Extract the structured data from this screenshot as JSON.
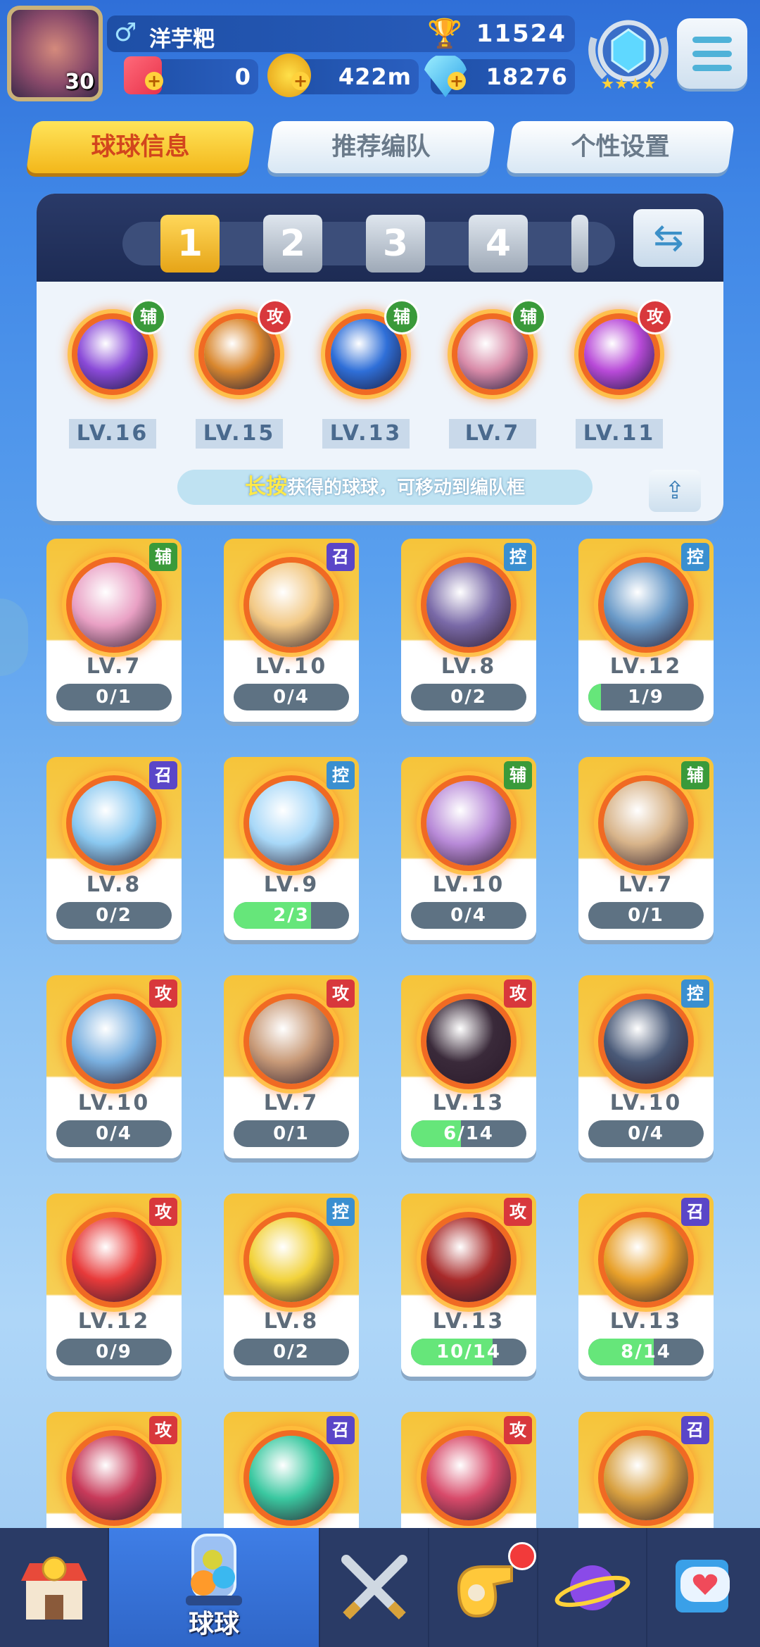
{
  "player": {
    "level": "30",
    "gender_icon": "male-symbol-icon",
    "name": "洋芋粑",
    "trophies": "11524",
    "card_count": "0",
    "coins": "422m",
    "diamonds": "18276"
  },
  "tabs": [
    {
      "label": "球球信息",
      "active": true
    },
    {
      "label": "推荐编队",
      "active": false
    },
    {
      "label": "个性设置",
      "active": false
    }
  ],
  "team": {
    "slots": [
      "1",
      "2",
      "3",
      "4"
    ],
    "active_slot": "1",
    "balls": [
      {
        "role": "辅",
        "level": "LV.16",
        "role_color": "#3a9a3a",
        "orb": "#8a4ad8"
      },
      {
        "role": "攻",
        "level": "LV.15",
        "role_color": "#d8383c",
        "orb": "#d9872e"
      },
      {
        "role": "辅",
        "level": "LV.13",
        "role_color": "#3a9a3a",
        "orb": "#2f6fd8"
      },
      {
        "role": "辅",
        "level": "LV.7",
        "role_color": "#3a9a3a",
        "orb": "#d88aa8"
      },
      {
        "role": "攻",
        "level": "LV.11",
        "role_color": "#d8383c",
        "orb": "#b84ad8"
      }
    ],
    "hint_highlight": "长按",
    "hint_text": "获得的球球，可移动到编队框"
  },
  "roles": {
    "辅": "#3a9a3a",
    "攻": "#d8383c",
    "召": "#5a46c8",
    "控": "#3a8fd0"
  },
  "collection": [
    {
      "role": "辅",
      "level": "LV.7",
      "progress": "0/1",
      "fill": 0,
      "orb": "#e9a0c4"
    },
    {
      "role": "召",
      "level": "LV.10",
      "progress": "0/4",
      "fill": 0,
      "orb": "#f2c884"
    },
    {
      "role": "控",
      "level": "LV.8",
      "progress": "0/2",
      "fill": 0,
      "orb": "#7a6aa8"
    },
    {
      "role": "控",
      "level": "LV.12",
      "progress": "1/9",
      "fill": 0.11,
      "orb": "#6a9ac8"
    },
    {
      "role": "召",
      "level": "LV.8",
      "progress": "0/2",
      "fill": 0,
      "orb": "#8ac8f0"
    },
    {
      "role": "控",
      "level": "LV.9",
      "progress": "2/3",
      "fill": 0.67,
      "orb": "#a8d8f8"
    },
    {
      "role": "辅",
      "level": "LV.10",
      "progress": "0/4",
      "fill": 0,
      "orb": "#b88ad8"
    },
    {
      "role": "辅",
      "level": "LV.7",
      "progress": "0/1",
      "fill": 0,
      "orb": "#d8b48a"
    },
    {
      "role": "攻",
      "level": "LV.10",
      "progress": "0/4",
      "fill": 0,
      "orb": "#7ab0e0"
    },
    {
      "role": "攻",
      "level": "LV.7",
      "progress": "0/1",
      "fill": 0,
      "orb": "#c89a78"
    },
    {
      "role": "攻",
      "level": "LV.13",
      "progress": "6/14",
      "fill": 0.43,
      "orb": "#3a2a3a"
    },
    {
      "role": "控",
      "level": "LV.10",
      "progress": "0/4",
      "fill": 0,
      "orb": "#4a5a78"
    },
    {
      "role": "攻",
      "level": "LV.12",
      "progress": "0/9",
      "fill": 0,
      "orb": "#e83a3a"
    },
    {
      "role": "控",
      "level": "LV.8",
      "progress": "0/2",
      "fill": 0,
      "orb": "#f2d23a"
    },
    {
      "role": "攻",
      "level": "LV.13",
      "progress": "10/14",
      "fill": 0.71,
      "orb": "#a82a2a"
    },
    {
      "role": "召",
      "level": "LV.13",
      "progress": "8/14",
      "fill": 0.57,
      "orb": "#e8a02a"
    },
    {
      "role": "攻",
      "level": "",
      "progress": "",
      "fill": 0,
      "orb": "#c83a5a"
    },
    {
      "role": "召",
      "level": "",
      "progress": "",
      "fill": 0,
      "orb": "#3ac8a0"
    },
    {
      "role": "攻",
      "level": "",
      "progress": "",
      "fill": 0,
      "orb": "#d84a6a"
    },
    {
      "role": "召",
      "level": "",
      "progress": "",
      "fill": 0,
      "orb": "#d8a040"
    }
  ],
  "nav": [
    {
      "name": "shop",
      "icon": "shop-icon",
      "label": "",
      "active": false
    },
    {
      "name": "balls",
      "icon": "ball-jar-icon",
      "label": "球球",
      "active": true
    },
    {
      "name": "battle",
      "icon": "crossed-swords-icon",
      "label": "",
      "active": false
    },
    {
      "name": "team",
      "icon": "whistle-icon",
      "label": "",
      "active": false,
      "badge": true
    },
    {
      "name": "planet",
      "icon": "planet-icon",
      "label": "",
      "active": false
    },
    {
      "name": "social",
      "icon": "heart-chat-icon",
      "label": "",
      "active": false
    }
  ]
}
